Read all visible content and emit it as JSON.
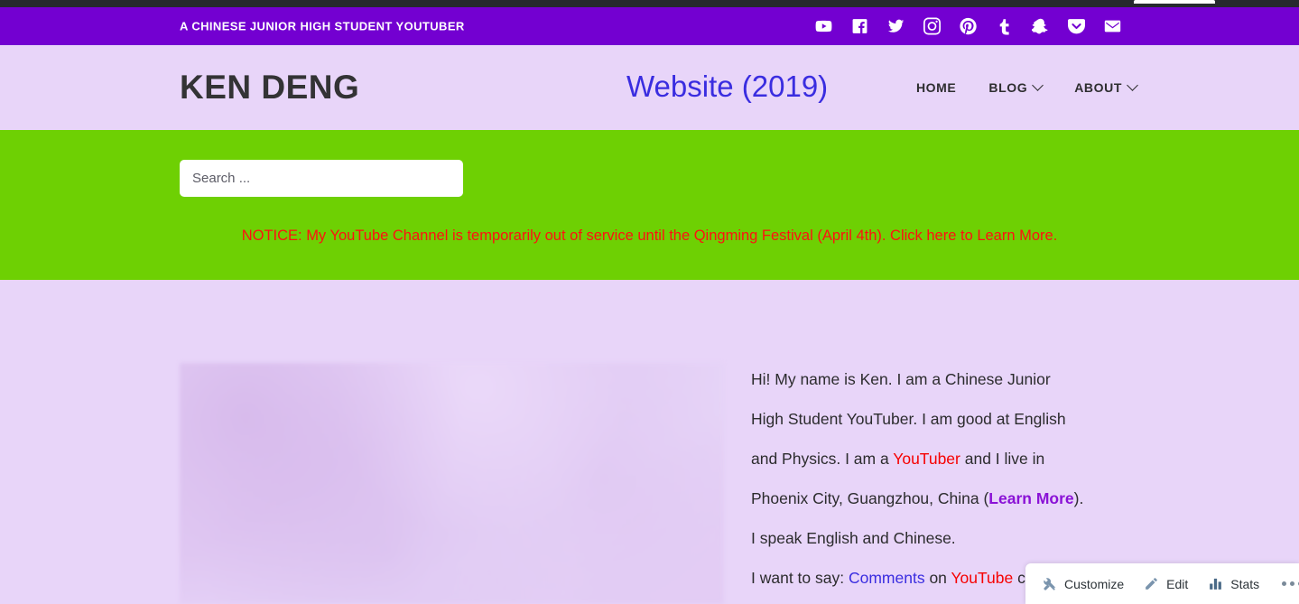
{
  "browser": {
    "tab_sliver": ""
  },
  "topbar": {
    "tagline": "A CHINESE JUNIOR HIGH STUDENT YOUTUBER",
    "background_color": "#7300d1",
    "social": [
      {
        "name": "youtube-icon",
        "label": "YouTube"
      },
      {
        "name": "facebook-icon",
        "label": "Facebook"
      },
      {
        "name": "twitter-icon",
        "label": "Twitter"
      },
      {
        "name": "instagram-icon",
        "label": "Instagram"
      },
      {
        "name": "pinterest-icon",
        "label": "Pinterest"
      },
      {
        "name": "tumblr-icon",
        "label": "Tumblr"
      },
      {
        "name": "snapchat-icon",
        "label": "Snapchat"
      },
      {
        "name": "pocket-icon",
        "label": "Pocket"
      },
      {
        "name": "email-icon",
        "label": "Email"
      }
    ]
  },
  "header": {
    "site_title": "KEN DENG",
    "site_description": "Website (2019)",
    "description_color": "#3a2de0",
    "background_color": "#e8d5f9",
    "nav": [
      {
        "label": "HOME",
        "has_dropdown": false
      },
      {
        "label": "BLOG",
        "has_dropdown": true
      },
      {
        "label": "ABOUT",
        "has_dropdown": true
      }
    ]
  },
  "band": {
    "background_color": "#6ed003",
    "search": {
      "placeholder": "Search ...",
      "value": ""
    },
    "notice": {
      "prefix": "NOTICE: My YouTube Channel is temporarily out of service until the Qingming Festival (April 4th). ",
      "link_text": "Click here to Learn More.",
      "color": "#fe1111"
    }
  },
  "main": {
    "bio": {
      "line1": "Hi! My name is Ken. I am a Chinese Junior",
      "line2": "High Student YouTuber.  I am good at English",
      "line3_a": "and Physics. I am a ",
      "line3_link": "YouTuber",
      "line3_b": " and I live in",
      "line4_a": "Phoenix City, Guangzhou, China (",
      "line4_link": "Learn More",
      "line4_b": ").",
      "line5": "I speak English and Chinese.",
      "line6_a": "I want to say: ",
      "line6_link1": "Comments",
      "line6_b": " on ",
      "line6_link2": "YouTube",
      "line6_c": " can"
    }
  },
  "adminbar": {
    "items": [
      {
        "icon": "customize-icon",
        "label": "Customize"
      },
      {
        "icon": "edit-pencil-icon",
        "label": "Edit"
      },
      {
        "icon": "stats-bars-icon",
        "label": "Stats"
      }
    ],
    "more_label": "More"
  }
}
